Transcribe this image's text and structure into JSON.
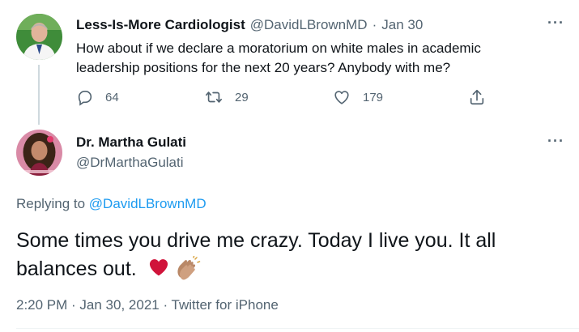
{
  "parent_tweet": {
    "display_name": "Less-Is-More Cardiologist",
    "handle": "@DavidLBrownMD",
    "separator": "·",
    "date": "Jan 30",
    "text": "How about if we declare a moratorium on white males in academic leadership positions for the next 20 years? Anybody with me?",
    "more": "···",
    "replies": "64",
    "retweets": "29",
    "likes": "179"
  },
  "main_tweet": {
    "display_name": "Dr. Martha Gulati",
    "handle": "@DrMarthaGulati",
    "more": "···",
    "replying_label": "Replying to",
    "replying_handle": "@DavidLBrownMD",
    "text": "Some times you drive me crazy. Today I live you. It all balances out.",
    "emoji": "❤️👏🏽",
    "timestamp": "2:20 PM · Jan 30, 2021 · Twitter for iPhone"
  },
  "colors": {
    "link": "#1d9bf0",
    "muted": "#536471",
    "heart_emoji": "#d0133a"
  },
  "icons": [
    "reply-icon",
    "retweet-icon",
    "like-icon",
    "share-icon",
    "more-icon"
  ]
}
